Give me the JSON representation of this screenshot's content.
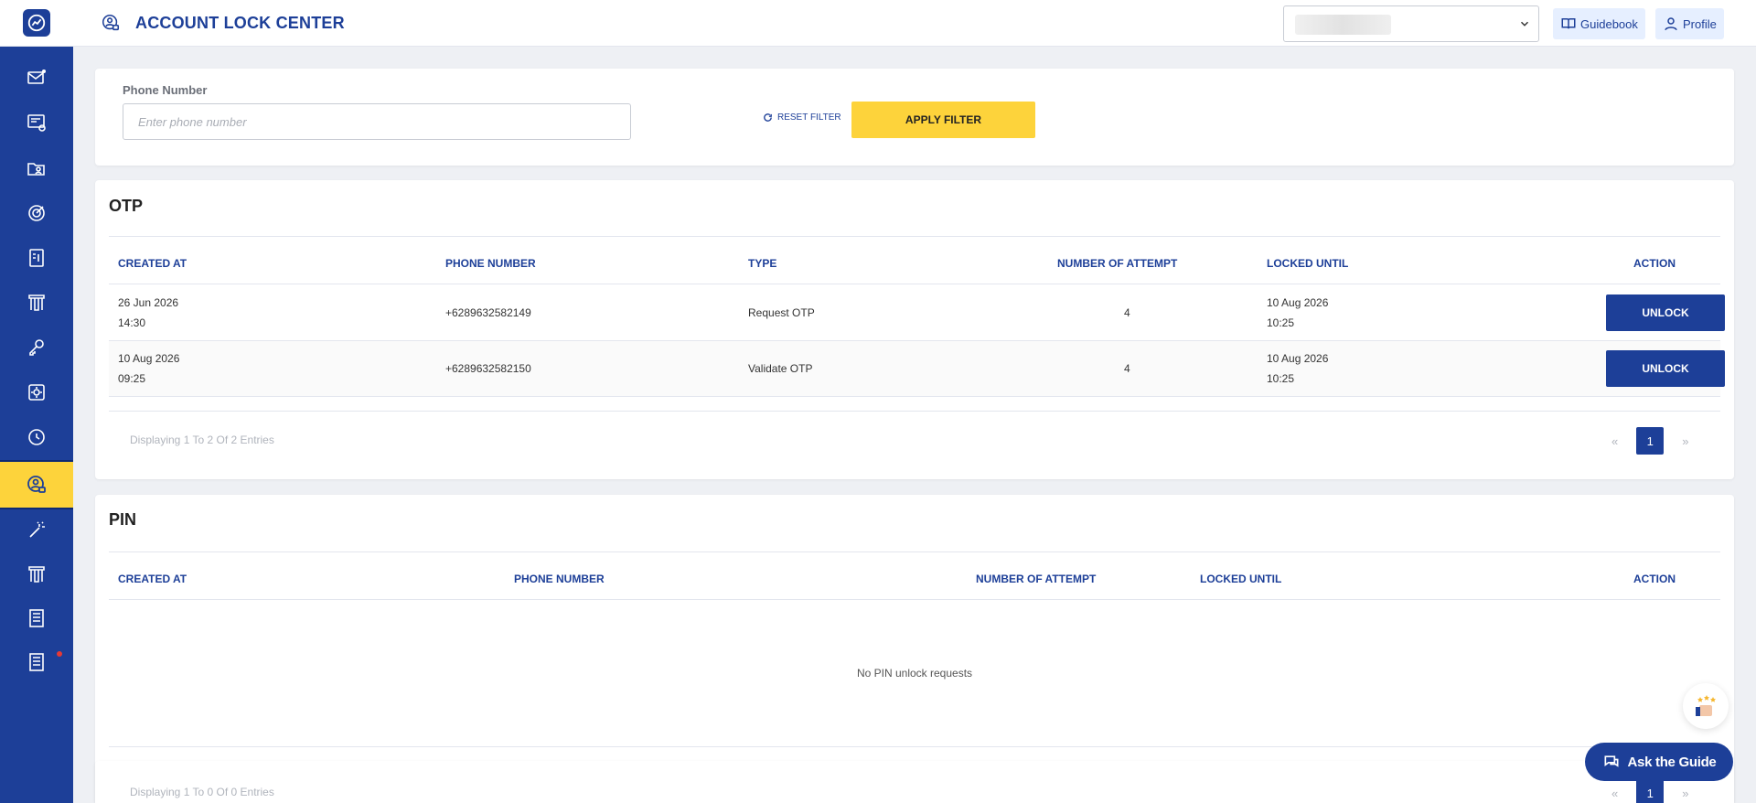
{
  "header": {
    "title": "ACCOUNT LOCK CENTER",
    "guidebook_label": "Guidebook",
    "profile_label": "Profile"
  },
  "sidebar": {
    "items": [
      {
        "icon": "mail-icon"
      },
      {
        "icon": "terminal-settings-icon"
      },
      {
        "icon": "folder-user-icon"
      },
      {
        "icon": "target-icon"
      },
      {
        "icon": "document-icon"
      },
      {
        "icon": "building-icon"
      },
      {
        "icon": "key-icon"
      },
      {
        "icon": "badge-settings-icon"
      },
      {
        "icon": "history-icon"
      },
      {
        "icon": "user-lock-icon",
        "active": true
      },
      {
        "icon": "magic-wand-icon"
      },
      {
        "icon": "building-icon"
      },
      {
        "icon": "receipt-icon"
      },
      {
        "icon": "receipt-alert-icon"
      }
    ]
  },
  "filter": {
    "phone_label": "Phone Number",
    "phone_value": "",
    "phone_placeholder": "Enter phone number",
    "reset_label": "RESET FILTER",
    "apply_label": "APPLY FILTER"
  },
  "otp": {
    "title": "OTP",
    "columns": {
      "created_at": "CREATED AT",
      "phone_number": "PHONE NUMBER",
      "type": "TYPE",
      "attempts": "NUMBER OF ATTEMPT",
      "locked_until": "LOCKED UNTIL",
      "action": "ACTION"
    },
    "rows": [
      {
        "created_date": "26 Jun 2026",
        "created_time": "14:30",
        "phone": "+6289632582149",
        "type": "Request OTP",
        "attempts": "4",
        "locked_date": "10 Aug 2026",
        "locked_time": "10:25",
        "action": "UNLOCK"
      },
      {
        "created_date": "10 Aug 2026",
        "created_time": "09:25",
        "phone": "+6289632582150",
        "type": "Validate OTP",
        "attempts": "4",
        "locked_date": "10 Aug 2026",
        "locked_time": "10:25",
        "action": "UNLOCK"
      }
    ],
    "pager_info": "Displaying 1 To 2 Of 2 Entries",
    "prev": "«",
    "page": "1",
    "next": "»"
  },
  "pin": {
    "title": "PIN",
    "columns": {
      "created_at": "CREATED AT",
      "phone_number": "PHONE NUMBER",
      "attempts": "NUMBER OF ATTEMPT",
      "locked_until": "LOCKED UNTIL",
      "action": "ACTION"
    },
    "empty_message": "No PIN unlock requests",
    "pager_info": "Displaying 1 To 0 Of 0 Entries",
    "prev": "«",
    "page": "1",
    "next": "»"
  },
  "floating": {
    "ask_guide_label": "Ask the Guide"
  },
  "colors": {
    "primary": "#1d3f98",
    "accent": "#fdd33b",
    "background": "#eef0f4"
  }
}
